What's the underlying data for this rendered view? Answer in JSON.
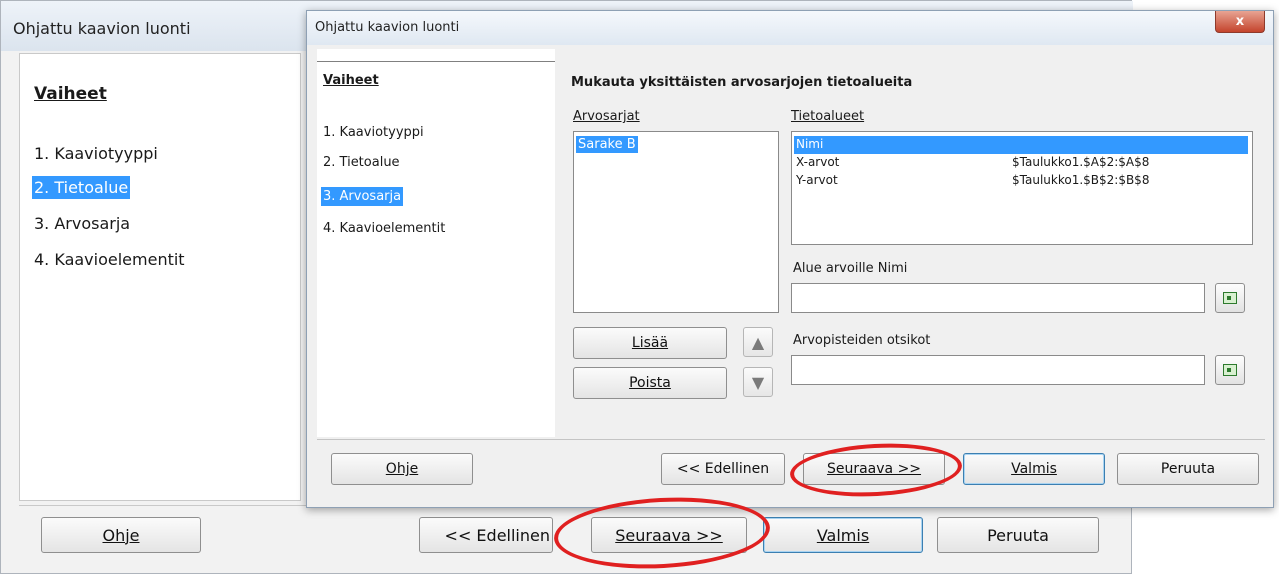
{
  "background_dialog": {
    "title": "Ohjattu kaavion luonti",
    "steps_heading": "Vaiheet",
    "steps": [
      {
        "label": "1. Kaaviotyyppi",
        "selected": false
      },
      {
        "label": "2. Tietoalue",
        "selected": true
      },
      {
        "label": "3. Arvosarja",
        "selected": false
      },
      {
        "label": "4. Kaavioelementit",
        "selected": false
      }
    ],
    "buttons": {
      "help": "Ohje",
      "back": "<< Edellinen",
      "next": "Seuraava >>",
      "finish": "Valmis",
      "cancel": "Peruuta"
    }
  },
  "dialog": {
    "title": "Ohjattu kaavion luonti",
    "close_glyph": "x",
    "steps_heading": "Vaiheet",
    "steps": [
      {
        "label": "1. Kaaviotyyppi",
        "selected": false
      },
      {
        "label": "2. Tietoalue",
        "selected": false
      },
      {
        "label": "3. Arvosarja",
        "selected": true
      },
      {
        "label": "4. Kaavioelementit",
        "selected": false
      }
    ],
    "content_title": "Mukauta yksittäisten arvosarjojen tietoalueita",
    "series_label": "Arvosarjat",
    "series": [
      "Sarake B"
    ],
    "ranges_label": "Tietoalueet",
    "ranges": [
      {
        "name": "Nimi",
        "value": "",
        "selected": true
      },
      {
        "name": "X-arvot",
        "value": "$Taulukko1.$A$2:$A$8",
        "selected": false
      },
      {
        "name": "Y-arvot",
        "value": "$Taulukko1.$B$2:$B$8",
        "selected": false
      }
    ],
    "range_for_label": "Alue arvoille Nimi",
    "range_for_value": "",
    "categories_label": "Arvopisteiden otsikot",
    "categories_value": "",
    "add_button": "Lisää",
    "remove_button": "Poista",
    "buttons": {
      "help": "Ohje",
      "back": "<< Edellinen",
      "next": "Seuraava >>",
      "finish": "Valmis",
      "cancel": "Peruuta"
    }
  },
  "annotation_color": "#e02020",
  "selection_color": "#3399ff"
}
